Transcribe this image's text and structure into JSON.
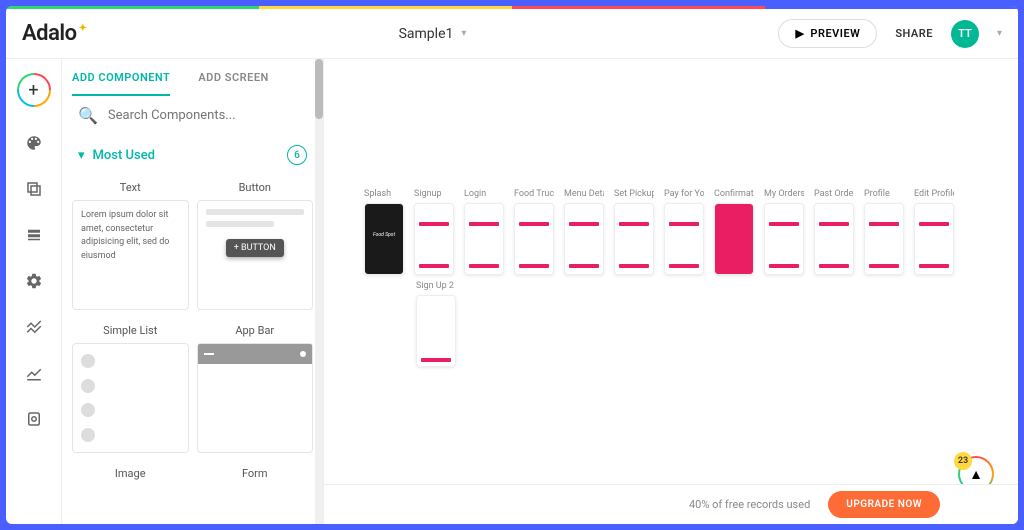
{
  "header": {
    "logo": "Adalo",
    "project_name": "Sample1",
    "preview_label": "PREVIEW",
    "share_label": "SHARE",
    "avatar_initials": "TT"
  },
  "panel": {
    "tabs": {
      "component": "ADD COMPONENT",
      "screen": "ADD SCREEN"
    },
    "search_placeholder": "Search Components...",
    "section_title": "Most Used",
    "section_count": "6",
    "components": {
      "text": {
        "title": "Text",
        "sample": "Lorem ipsum dolor sit amet, consectetur adipisicing elit, sed do eiusmod"
      },
      "button": {
        "title": "Button",
        "label": "+ BUTTON"
      },
      "simple_list": {
        "title": "Simple List"
      },
      "app_bar": {
        "title": "App Bar"
      },
      "image": {
        "title": "Image"
      },
      "form": {
        "title": "Form"
      }
    }
  },
  "canvas": {
    "screens": [
      {
        "label": "Splash",
        "variant": "dark"
      },
      {
        "label": "Signup",
        "variant": "light"
      },
      {
        "label": "Login",
        "variant": "light"
      },
      {
        "label": "Food Truck",
        "variant": "light"
      },
      {
        "label": "Menu Deta",
        "variant": "light"
      },
      {
        "label": "Set Pickup",
        "variant": "light"
      },
      {
        "label": "Pay for You",
        "variant": "light"
      },
      {
        "label": "Confirmati",
        "variant": "pink"
      },
      {
        "label": "My Orders",
        "variant": "light"
      },
      {
        "label": "Past Order",
        "variant": "light"
      },
      {
        "label": "Profile",
        "variant": "light"
      },
      {
        "label": "Edit Profile",
        "variant": "light"
      }
    ],
    "extra_screen": "Sign Up 2"
  },
  "footer": {
    "records_text": "40% of free records used",
    "upgrade_label": "UPGRADE NOW",
    "badge_count": "23"
  }
}
